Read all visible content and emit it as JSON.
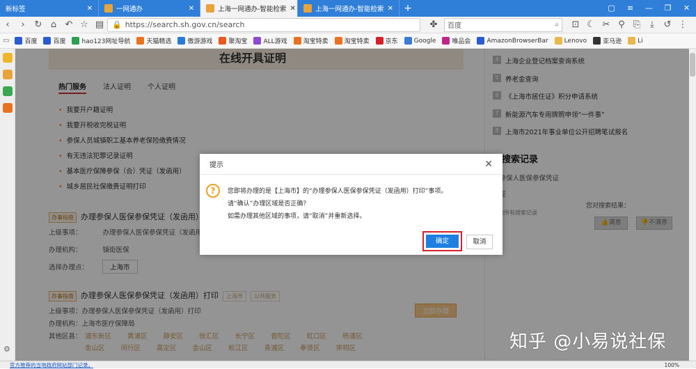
{
  "tabs": [
    {
      "label": "新标签",
      "active": false
    },
    {
      "label": "一网通办",
      "active": false
    },
    {
      "label": "上海一网通办-智能检索",
      "active": true
    },
    {
      "label": "上海一网通办-智能检索",
      "active": false
    }
  ],
  "navbar": {
    "url": "https://search.sh.gov.cn/search",
    "search_placeholder": "百度"
  },
  "bookmarks": [
    {
      "label": "百度",
      "color": "#2a5bd6"
    },
    {
      "label": "百度",
      "color": "#2a5bd6"
    },
    {
      "label": "hao123网址导航",
      "color": "#2aa050"
    },
    {
      "label": "天猫精选",
      "color": "#e8721e"
    },
    {
      "label": "傲游游戏",
      "color": "#2a7bd6"
    },
    {
      "label": "聚淘宝",
      "color": "#ea5a1e"
    },
    {
      "label": "ALL游戏",
      "color": "#8a4ad6"
    },
    {
      "label": "淘宝特卖",
      "color": "#e8721e"
    },
    {
      "label": "淘宝特卖",
      "color": "#e8721e"
    },
    {
      "label": "京东",
      "color": "#d6202a"
    },
    {
      "label": "Google",
      "color": "#3a7bd6"
    },
    {
      "label": "唯品会",
      "color": "#c0248a"
    },
    {
      "label": "AmazonBrowserBar",
      "color": "#2a5bd6"
    },
    {
      "label": "Lenovo",
      "color": "#e8b84a"
    },
    {
      "label": "亚马逊",
      "color": "#333333"
    },
    {
      "label": "Li",
      "color": "#e8b84a"
    }
  ],
  "page": {
    "banner_title": "在线开具证明",
    "hot_tabs": [
      "热门服务",
      "法人证明",
      "个人证明"
    ],
    "hot_items": [
      "我要开户籍证明",
      "我要开税收完税证明",
      "参保人员城镇职工基本养老保险缴费情况",
      "有无违法犯罪记录证明",
      "基本医疗保障参保（合）凭证（发函用）",
      "城乡居民社保缴费证明打印"
    ],
    "result1": {
      "tag": "办事指南",
      "title": "办理参保人医保参保凭证（发函用）打印",
      "superior_label": "上级事项：",
      "superior_value": "办理参保人医保参保凭证（发函用）打印",
      "org_label": "办理机构：",
      "org_value": "镇街医保",
      "region_label": "选择办理点：",
      "region_value": "上海市"
    },
    "result2": {
      "tag": "办事指南",
      "title": "办理参保人医保参保凭证（发函用）打印",
      "tag_region": "上海市",
      "tag_public": "公共服务",
      "superior_text": "上级事项：办理参保人医保参保凭证（发函用）打印",
      "org_text": "办理机构：上海市医疗保障局",
      "other_label": "其他区县：",
      "districts_row1": [
        "浦东新区",
        "黄浦区",
        "静安区",
        "徐汇区",
        "长宁区",
        "普陀区",
        "虹口区",
        "杨浦区"
      ],
      "districts_row2": [
        "金山区",
        "闵行区",
        "嘉定区",
        "金山区",
        "松江区",
        "青浦区",
        "奉贤区",
        "崇明区"
      ],
      "apply_button": "立即办理"
    },
    "right_list": [
      {
        "num": "4",
        "text": "上海企业登记档案查询系统"
      },
      {
        "num": "5",
        "text": "养老金查询"
      },
      {
        "num": "6",
        "text": "《上海市居住证》积分申请系统"
      },
      {
        "num": "7",
        "text": "新能源汽车专用牌照申领“一件事”"
      },
      {
        "num": "8",
        "text": "上海市2021年事业单位公开招聘笔试报名"
      }
    ],
    "recent": {
      "title": "近搜索记录",
      "item1": "保参保人医保参保凭证",
      "item2": "凭证",
      "clear": "清除所有搜索记录"
    },
    "feedback": {
      "label": "您对搜索结果：",
      "satisfied": "满意",
      "unsatisfied": "不满意"
    }
  },
  "dialog": {
    "title": "提示",
    "line1": "您即将办理的是【上海市】的“办理参保人医保参保凭证（发函用）打印”事项。",
    "line2": "请“确认”办理区域是否正确？",
    "line3": "如需办理其他区域的事项，请“取消”并重新选择。",
    "ok": "确定",
    "cancel": "取消"
  },
  "watermark": "知乎 @小易说社保",
  "statusbar": {
    "link": "官方推荐的当地政府网站部门记录。",
    "zoom": "100%"
  }
}
